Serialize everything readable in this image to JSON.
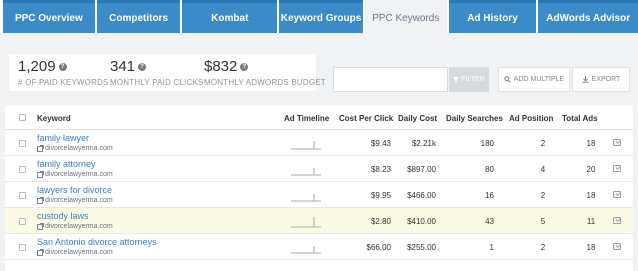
{
  "tabs": [
    {
      "label": "PPC Overview"
    },
    {
      "label": "Competitors"
    },
    {
      "label": "Kombat"
    },
    {
      "label": "Keyword Groups"
    },
    {
      "label": "PPC Keywords",
      "active": true
    },
    {
      "label": "Ad History"
    },
    {
      "label": "AdWords Advisor"
    }
  ],
  "stats": [
    {
      "value": "1,209",
      "label": "# OF PAID KEYWORDS"
    },
    {
      "value": "341",
      "label": "MONTHLY PAID CLICKS"
    },
    {
      "value": "$832",
      "label": "MONTHLY ADWORDS BUDGET"
    }
  ],
  "filter": {
    "button_label": "FILTER",
    "value": ""
  },
  "actions": {
    "add_multiple": "ADD MULTIPLE",
    "export": "EXPORT"
  },
  "table": {
    "headers": {
      "keyword": "Keyword",
      "ad_timeline": "Ad Timeline",
      "cost_per_click": "Cost Per Click",
      "daily_cost": "Daily Cost",
      "daily_searches": "Daily Searches",
      "ad_position": "Ad Position",
      "total_ads": "Total Ads"
    },
    "rows": [
      {
        "keyword": "family lawyer",
        "domain": "divorcelawyerma.com",
        "cpc": "$9.43",
        "daily_cost": "$2.21k",
        "daily_searches": "180",
        "ad_position": "2",
        "total_ads": "18",
        "highlighted": false,
        "timeline_bar": 0.72
      },
      {
        "keyword": "family attorney",
        "domain": "divorcelawyerma.com",
        "cpc": "$8.23",
        "daily_cost": "$897.00",
        "daily_searches": "80",
        "ad_position": "4",
        "total_ads": "20",
        "highlighted": false,
        "timeline_bar": 0.55
      },
      {
        "keyword": "lawyers for divorce",
        "domain": "divorcelawyerma.com",
        "cpc": "$9.95",
        "daily_cost": "$466.00",
        "daily_searches": "16",
        "ad_position": "2",
        "total_ads": "18",
        "highlighted": false,
        "timeline_bar": 0.6
      },
      {
        "keyword": "custody laws",
        "domain": "divorcelawyerma.com",
        "cpc": "$2.80",
        "daily_cost": "$410.00",
        "daily_searches": "43",
        "ad_position": "5",
        "total_ads": "11",
        "highlighted": true,
        "timeline_bar": 0.85
      },
      {
        "keyword": "San Antonio divorce attorneys",
        "domain": "divorcelawyerma.com",
        "cpc": "$66.00",
        "daily_cost": "$255.00",
        "daily_searches": "1",
        "ad_position": "2",
        "total_ads": "18",
        "highlighted": false,
        "timeline_bar": 0.6
      }
    ]
  }
}
